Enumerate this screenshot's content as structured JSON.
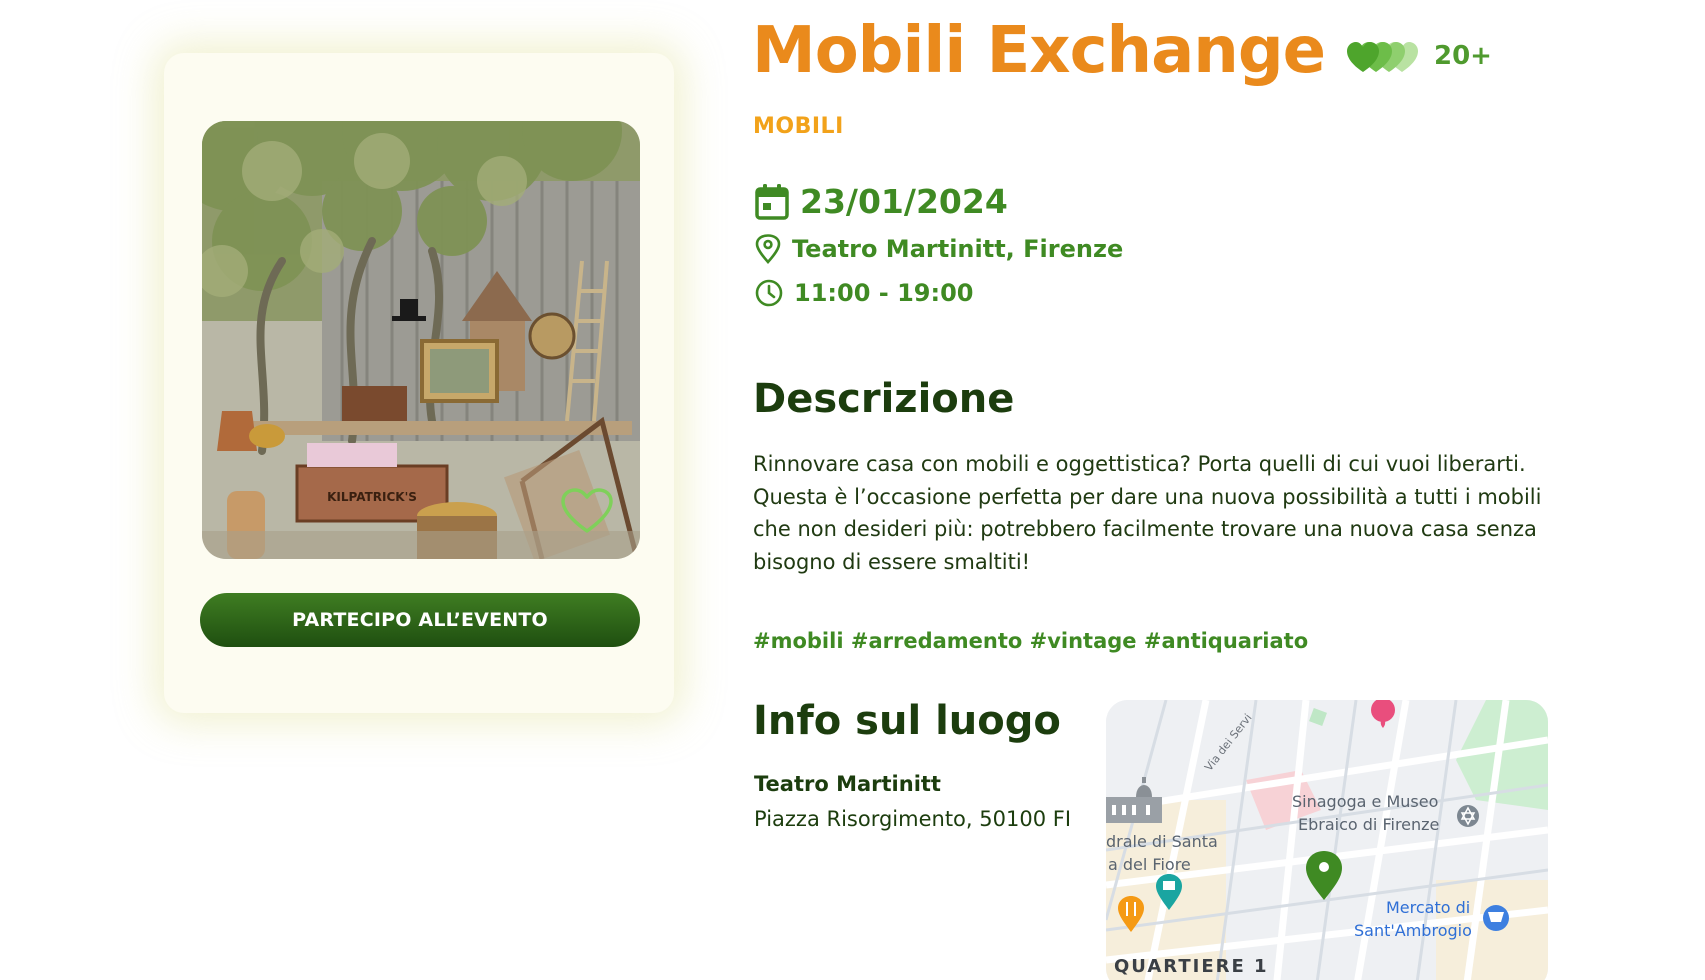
{
  "event": {
    "title": "Mobili Exchange",
    "category": "MOBILI",
    "likes_count": "20+",
    "date": "23/01/2024",
    "location": "Teatro Martinitt, Firenze",
    "time": "11:00 - 19:00"
  },
  "card": {
    "cta_label": "PARTECIPO ALL’EVENTO",
    "photo_sign_text": "KILPATRICK'S"
  },
  "description": {
    "heading": "Descrizione",
    "text": "Rinnovare casa con mobili e oggettistica? Porta quelli di cui vuoi liberarti. Questa è l’occasione perfetta per dare una nuova possibilità a tutti i mobili che non desideri più: potrebbero facilmente trovare una nuova casa senza bisogno di essere smaltiti!",
    "tags": "#mobili #arredamento #vintage #antiquariato"
  },
  "venue": {
    "heading": "Info sul luogo",
    "name": "Teatro Martinitt",
    "address": "Piazza Risorgimento, 50100 FI"
  },
  "map": {
    "labels": {
      "street": "Via dei Servi",
      "synagogue_line1": "Sinagoga e Museo",
      "synagogue_line2": "Ebraico di Firenze",
      "cathedral_line1": "drale di Santa",
      "cathedral_line2": "a del Fiore",
      "market_line1": "Mercato di",
      "market_line2": "Sant'Ambrogio",
      "district": "QUARTIERE 1"
    }
  },
  "colors": {
    "title_orange": "#ea8a1c",
    "category_orange": "#f2a21a",
    "green_accent": "#3f8a23",
    "dark_green": "#1c3d0e",
    "cta_green": "#2d6618",
    "card_bg": "#fdfcf1"
  },
  "icons": {
    "date": "calendar-icon",
    "location": "map-pin-icon",
    "time": "clock-icon",
    "favorite": "heart-outline-icon",
    "likes": "hearts-stack-icon"
  }
}
